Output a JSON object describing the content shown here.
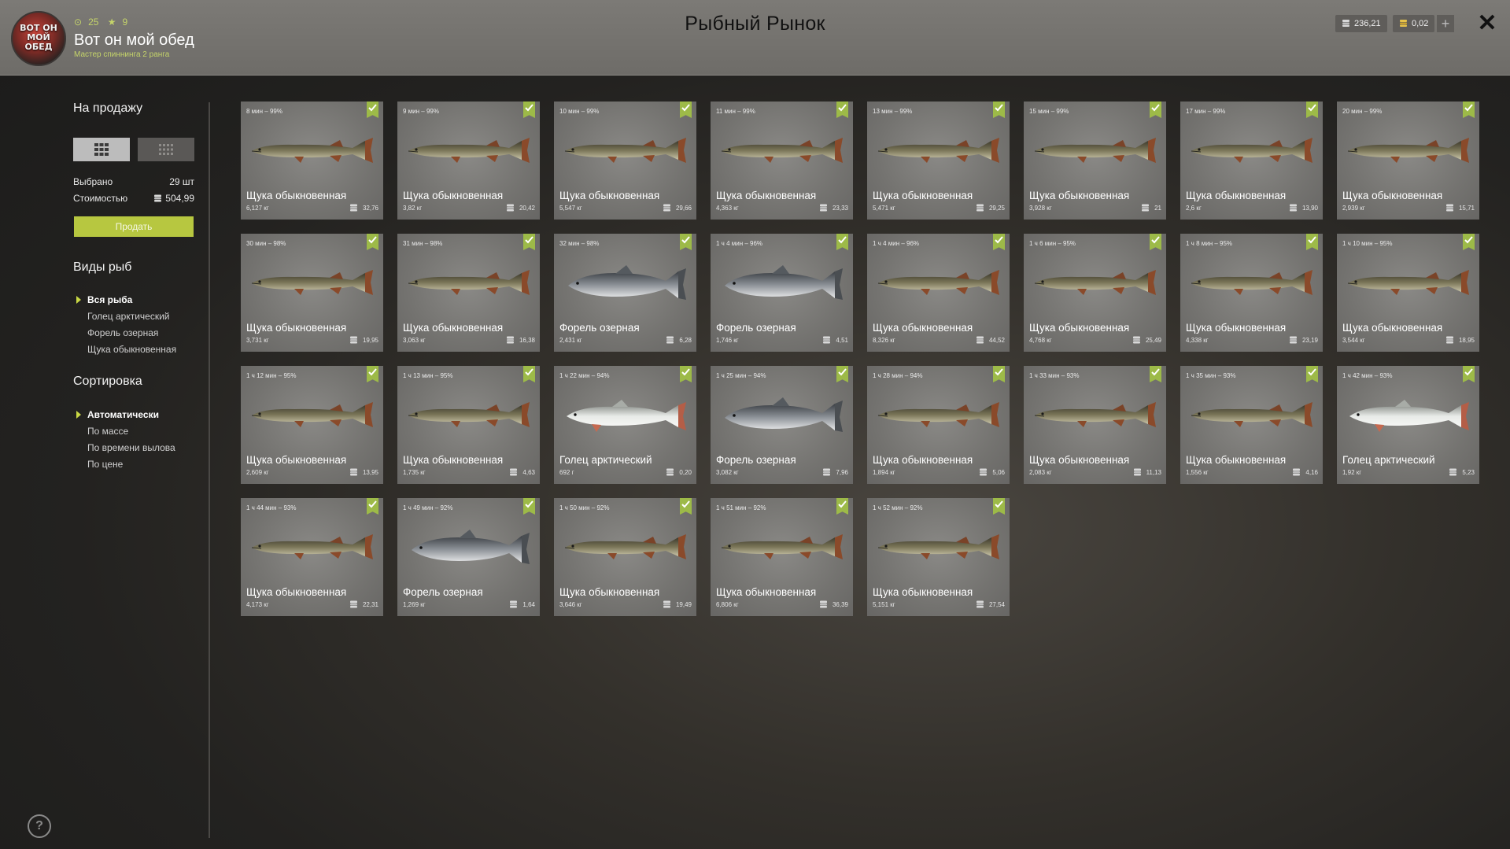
{
  "header": {
    "title": "Рыбный Рынок",
    "player": {
      "name": "Вот он мой обед",
      "rank": "Мастер спиннинга 2 ранга",
      "level": "25",
      "stars": "9",
      "avatar_text": "ВОТ ОН МОЙ ОБЕД"
    },
    "currency": {
      "silver": "236,21",
      "gold": "0,02"
    },
    "add_label": "+",
    "close_label": "✕"
  },
  "sidebar": {
    "for_sale_title": "На продажу",
    "selected_label": "Выбрано",
    "selected_value": "29 шт",
    "cost_label": "Стоимостью",
    "cost_value": "504,99",
    "sell_button": "Продать",
    "species_title": "Виды рыб",
    "species": [
      "Вся рыба",
      "Голец арктический",
      "Форель озерная",
      "Щука обыкновенная"
    ],
    "sort_title": "Сортировка",
    "sort_options": [
      "Автоматически",
      "По массе",
      "По времени вылова",
      "По цене"
    ],
    "help_label": "?"
  },
  "colors": {
    "accent": "#b7c740",
    "check": "#9dba48",
    "header_bg": "#75736f"
  },
  "fish": [
    {
      "time": "8 мин – 99%",
      "name": "Щука обыкновенная",
      "weight": "6,127 кг",
      "price": "32,76",
      "type": "pike"
    },
    {
      "time": "9 мин – 99%",
      "name": "Щука обыкновенная",
      "weight": "3,82 кг",
      "price": "20,42",
      "type": "pike"
    },
    {
      "time": "10 мин – 99%",
      "name": "Щука обыкновенная",
      "weight": "5,547 кг",
      "price": "29,66",
      "type": "pike"
    },
    {
      "time": "11 мин – 99%",
      "name": "Щука обыкновенная",
      "weight": "4,363 кг",
      "price": "23,33",
      "type": "pike"
    },
    {
      "time": "13 мин – 99%",
      "name": "Щука обыкновенная",
      "weight": "5,471 кг",
      "price": "29,25",
      "type": "pike"
    },
    {
      "time": "15 мин – 99%",
      "name": "Щука обыкновенная",
      "weight": "3,928 кг",
      "price": "21",
      "type": "pike"
    },
    {
      "time": "17 мин – 99%",
      "name": "Щука обыкновенная",
      "weight": "2,6 кг",
      "price": "13,90",
      "type": "pike"
    },
    {
      "time": "20 мин – 99%",
      "name": "Щука обыкновенная",
      "weight": "2,939 кг",
      "price": "15,71",
      "type": "pike"
    },
    {
      "time": "30 мин – 98%",
      "name": "Щука обыкновенная",
      "weight": "3,731 кг",
      "price": "19,95",
      "type": "pike"
    },
    {
      "time": "31 мин – 98%",
      "name": "Щука обыкновенная",
      "weight": "3,063 кг",
      "price": "16,38",
      "type": "pike"
    },
    {
      "time": "32 мин – 98%",
      "name": "Форель озерная",
      "weight": "2,431 кг",
      "price": "6,28",
      "type": "trout"
    },
    {
      "time": "1 ч 4 мин – 96%",
      "name": "Форель озерная",
      "weight": "1,746 кг",
      "price": "4,51",
      "type": "trout"
    },
    {
      "time": "1 ч 4 мин – 96%",
      "name": "Щука обыкновенная",
      "weight": "8,326 кг",
      "price": "44,52",
      "type": "pike"
    },
    {
      "time": "1 ч 6 мин – 95%",
      "name": "Щука обыкновенная",
      "weight": "4,768 кг",
      "price": "25,49",
      "type": "pike"
    },
    {
      "time": "1 ч 8 мин – 95%",
      "name": "Щука обыкновенная",
      "weight": "4,338 кг",
      "price": "23,19",
      "type": "pike"
    },
    {
      "time": "1 ч 10 мин – 95%",
      "name": "Щука обыкновенная",
      "weight": "3,544 кг",
      "price": "18,95",
      "type": "pike"
    },
    {
      "time": "1 ч 12 мин – 95%",
      "name": "Щука обыкновенная",
      "weight": "2,609 кг",
      "price": "13,95",
      "type": "pike"
    },
    {
      "time": "1 ч 13 мин – 95%",
      "name": "Щука обыкновенная",
      "weight": "1,735 кг",
      "price": "4,63",
      "type": "pike"
    },
    {
      "time": "1 ч 22 мин – 94%",
      "name": "Голец арктический",
      "weight": "692 г",
      "price": "0,20",
      "type": "char"
    },
    {
      "time": "1 ч 25 мин – 94%",
      "name": "Форель озерная",
      "weight": "3,082 кг",
      "price": "7,96",
      "type": "trout"
    },
    {
      "time": "1 ч 28 мин – 94%",
      "name": "Щука обыкновенная",
      "weight": "1,894 кг",
      "price": "5,06",
      "type": "pike"
    },
    {
      "time": "1 ч 33 мин – 93%",
      "name": "Щука обыкновенная",
      "weight": "2,083 кг",
      "price": "11,13",
      "type": "pike"
    },
    {
      "time": "1 ч 35 мин – 93%",
      "name": "Щука обыкновенная",
      "weight": "1,556 кг",
      "price": "4,16",
      "type": "pike"
    },
    {
      "time": "1 ч 42 мин – 93%",
      "name": "Голец арктический",
      "weight": "1,92 кг",
      "price": "5,23",
      "type": "char"
    },
    {
      "time": "1 ч 44 мин – 93%",
      "name": "Щука обыкновенная",
      "weight": "4,173 кг",
      "price": "22,31",
      "type": "pike"
    },
    {
      "time": "1 ч 49 мин – 92%",
      "name": "Форель озерная",
      "weight": "1,269 кг",
      "price": "1,64",
      "type": "trout"
    },
    {
      "time": "1 ч 50 мин – 92%",
      "name": "Щука обыкновенная",
      "weight": "3,646 кг",
      "price": "19,49",
      "type": "pike"
    },
    {
      "time": "1 ч 51 мин – 92%",
      "name": "Щука обыкновенная",
      "weight": "6,806 кг",
      "price": "36,39",
      "type": "pike"
    },
    {
      "time": "1 ч 52 мин – 92%",
      "name": "Щука обыкновенная",
      "weight": "5,151 кг",
      "price": "27,54",
      "type": "pike"
    }
  ]
}
